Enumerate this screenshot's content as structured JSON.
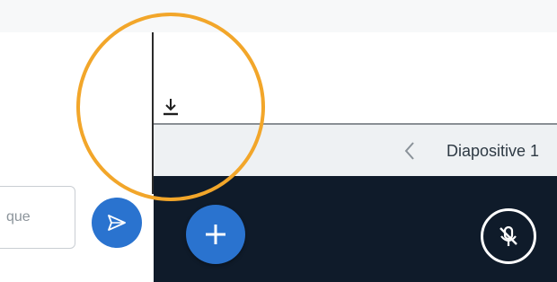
{
  "chat": {
    "input_value": "que",
    "send_icon": "send-icon"
  },
  "toolbar": {
    "download_icon": "download-icon"
  },
  "slide_nav": {
    "prev_icon": "chevron-left-icon",
    "title": "Diapositive 1"
  },
  "controls": {
    "add_icon": "plus-icon",
    "mute_icon": "microphone-muted-icon"
  },
  "colors": {
    "accent_blue": "#2a73cf",
    "highlight_orange": "#f2a62a",
    "dark_panel": "#0f1b2a",
    "nav_bar": "#eef1f3"
  }
}
